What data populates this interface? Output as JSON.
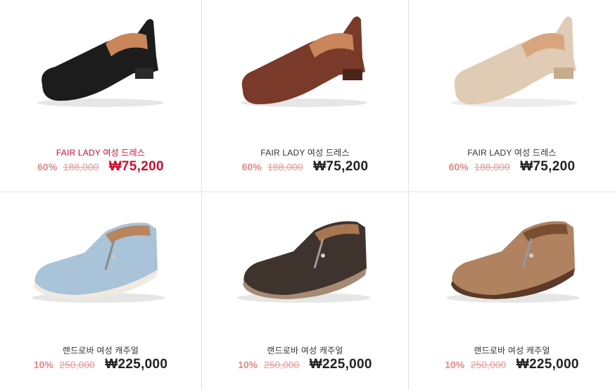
{
  "products": [
    {
      "name": "FAIR LADY 여성 드레스",
      "discount": "60%",
      "original_price": "188,000",
      "price": "₩75,200",
      "color": "#1c1c1c",
      "style": "loafer"
    },
    {
      "name": "FAIR LADY 여성 드레스",
      "discount": "60%",
      "original_price": "188,000",
      "price": "₩75,200",
      "color": "#7a3a2a",
      "style": "loafer"
    },
    {
      "name": "FAIR LADY 여성 드레스",
      "discount": "60%",
      "original_price": "188,000",
      "price": "₩75,200",
      "color": "#e0cbb4",
      "style": "loafer"
    },
    {
      "name": "랜드로바 여성 캐주얼",
      "discount": "10%",
      "original_price": "250,000",
      "price": "₩225,000",
      "color": "#a9c3d8",
      "style": "zip-casual"
    },
    {
      "name": "랜드로바 여성 캐주얼",
      "discount": "10%",
      "original_price": "250,000",
      "price": "₩225,000",
      "color": "#3e332d",
      "style": "zip-casual"
    },
    {
      "name": "랜드로바 여성 캐주얼",
      "discount": "10%",
      "original_price": "250,000",
      "price": "₩225,000",
      "color": "#b0825f",
      "style": "zip-casual"
    }
  ]
}
